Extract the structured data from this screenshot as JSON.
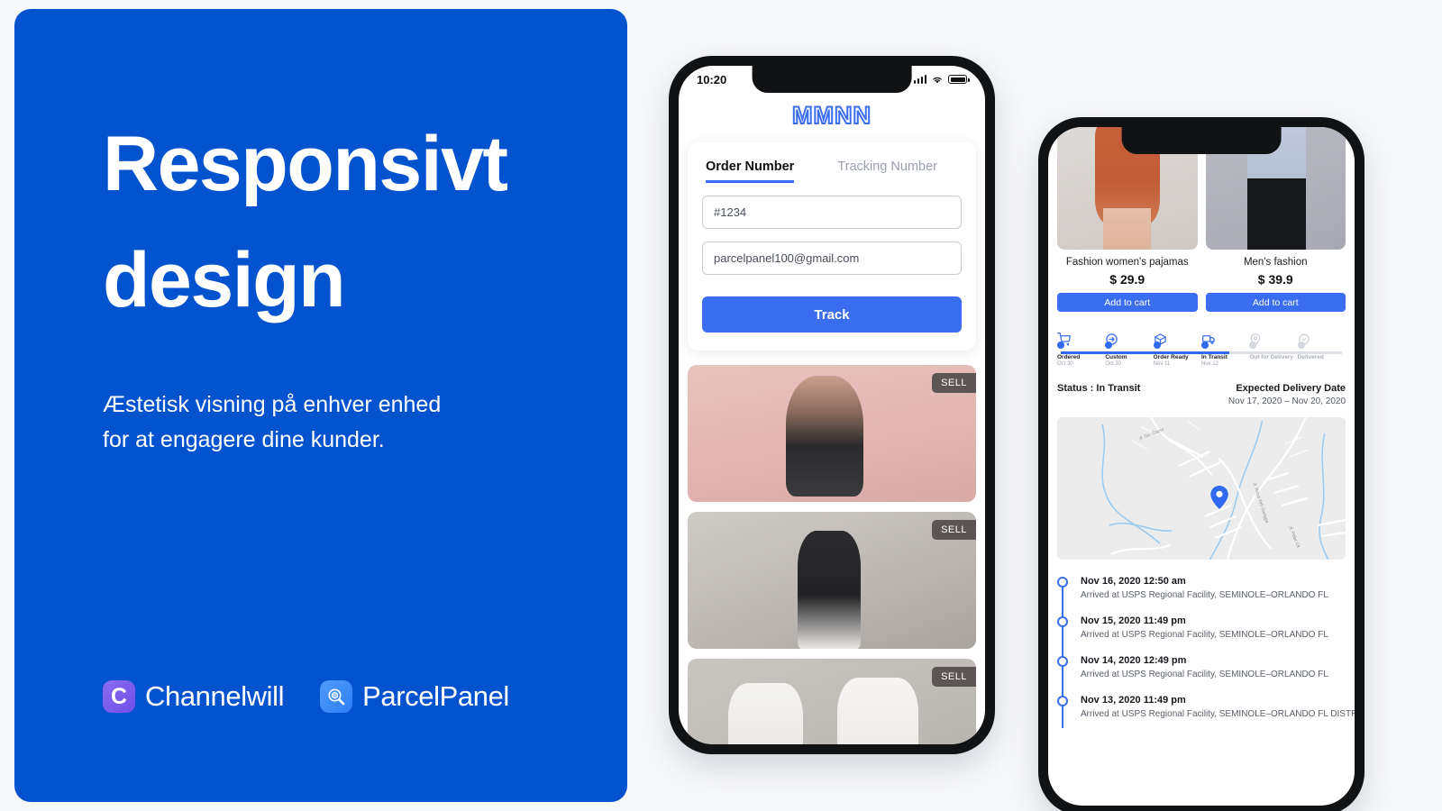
{
  "brand_colors": {
    "panel_blue": "#0453CE",
    "accent_blue": "#3A6DF0",
    "page_bg": "#F7F8FA",
    "badge_gray": "#5C5554",
    "timeline_blue": "#3A6DF0"
  },
  "panel": {
    "headline": "Responsivt design",
    "subtext": "Æstetisk visning på enhver enhed for at engagere dine kunder.",
    "logos": [
      {
        "mark": "C",
        "name": "Channelwill",
        "icon": "channelwill-c-icon"
      },
      {
        "mark": "",
        "name": "ParcelPanel",
        "icon": "parcelpanel-magnifier-icon"
      }
    ]
  },
  "phone_one": {
    "status_bar": {
      "time": "10:20",
      "icons": [
        "cellular-signal-icon",
        "wifi-icon",
        "battery-icon"
      ]
    },
    "store_brand": "MMNN",
    "track_card": {
      "tabs": [
        {
          "label": "Order Number",
          "active": true
        },
        {
          "label": "Tracking Number",
          "active": false
        }
      ],
      "order_number_value": "#1234",
      "order_number_placeholder": "#1234",
      "email_value": "parcelpanel100@gmail.com",
      "email_placeholder": "parcelpanel100@gmail.com",
      "submit_label": "Track"
    },
    "feed": [
      {
        "badge": "SELL",
        "alt": "woman-in-black-tee-pink-wall"
      },
      {
        "badge": "SELL",
        "alt": "man-in-black-tee-concrete-wall"
      },
      {
        "badge": "SELL",
        "alt": "two-people-white-force-majeure-tees"
      }
    ]
  },
  "phone_two": {
    "products": [
      {
        "name": "Fashion women's pajamas",
        "price": "$ 29.9",
        "cta": "Add to cart"
      },
      {
        "name": "Men's fashion",
        "price": "$ 39.9",
        "cta": "Add to cart"
      }
    ],
    "stepper": {
      "steps": [
        {
          "label": "Ordered",
          "date": "Oct 30",
          "icon": "shopping-cart-icon",
          "done": true
        },
        {
          "label": "Custom",
          "date": "Oct 30",
          "icon": "arrow-circle-icon",
          "done": true
        },
        {
          "label": "Order Ready",
          "date": "Nov 11",
          "icon": "box-icon",
          "done": true
        },
        {
          "label": "In Transit",
          "date": "Nov 12",
          "icon": "truck-icon",
          "done": true
        },
        {
          "label": "Out for Delivery",
          "date": "",
          "icon": "map-pin-icon",
          "done": false
        },
        {
          "label": "Delivered",
          "date": "",
          "icon": "check-circle-icon",
          "done": false
        }
      ]
    },
    "status": {
      "current": "Status : In Transit",
      "expected_title": "Expected Delivery Date",
      "expected_range": "Nov 17, 2020 – Nov 20, 2020"
    },
    "map": {
      "pin": "location-pin-icon",
      "street_labels": [
        "Jl. Gn. Gazur",
        "Jl. Raya Yeh Gangga",
        "Jl. Pidar Ck"
      ]
    },
    "history": [
      {
        "date": "Nov 16, 2020 12:50 am",
        "desc": "Arrived at USPS Regional Facility, SEMINOLE–ORLANDO FL"
      },
      {
        "date": "Nov 15, 2020 11:49 pm",
        "desc": "Arrived at USPS Regional Facility, SEMINOLE–ORLANDO FL"
      },
      {
        "date": "Nov 14, 2020 12:49 pm",
        "desc": "Arrived at USPS Regional Facility, SEMINOLE–ORLANDO FL"
      },
      {
        "date": "Nov 13, 2020 11:49 pm",
        "desc": "Arrived at USPS Regional Facility, SEMINOLE–ORLANDO FL DISTR"
      }
    ]
  }
}
